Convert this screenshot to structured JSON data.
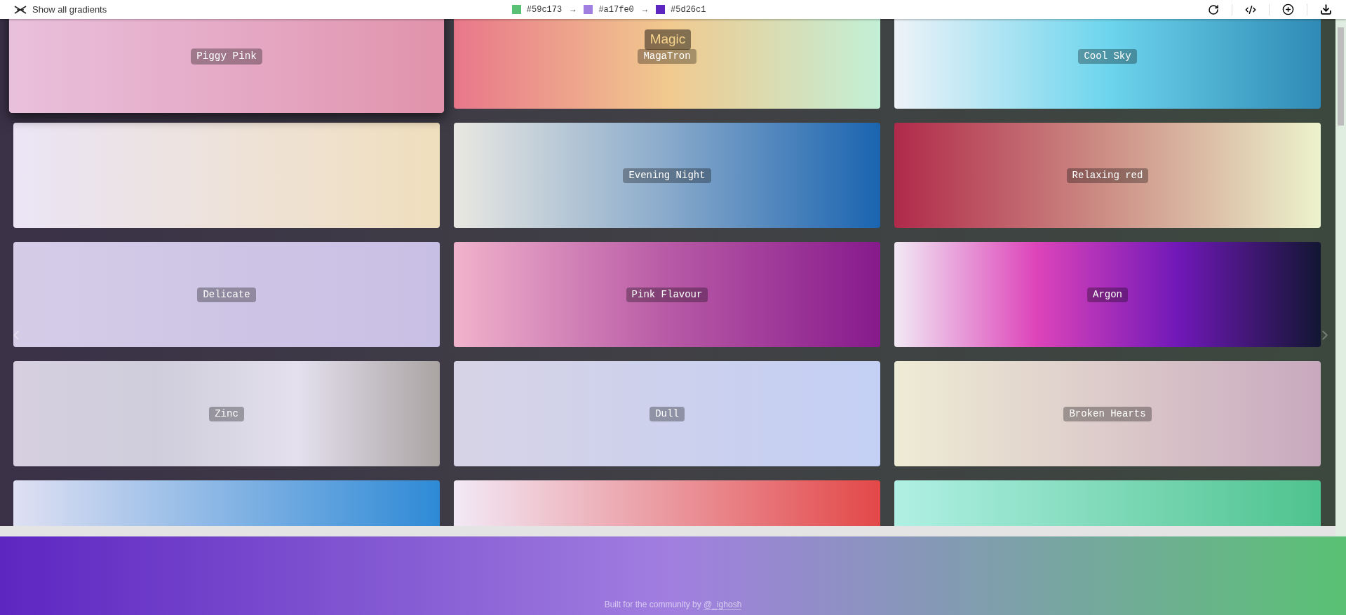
{
  "toolbar": {
    "show_all": "Show all gradients",
    "stops": [
      {
        "hex": "#59c173",
        "color": "#59c173"
      },
      {
        "hex": "#a17fe0",
        "color": "#a17fe0"
      },
      {
        "hex": "#5d26c1",
        "color": "#5d26c1"
      }
    ],
    "arrow": "→"
  },
  "title": "Magic",
  "gradients": [
    {
      "name": "Piggy Pink",
      "highlighted": true
    },
    {
      "name": "MagaTron",
      "highlighted": false
    },
    {
      "name": "Cool Sky",
      "highlighted": false
    },
    {
      "highlighted": false
    },
    {
      "name": "Evening Night",
      "highlighted": false
    },
    {
      "name": "Relaxing red",
      "highlighted": false
    },
    {
      "name": "Delicate",
      "highlighted": false
    },
    {
      "name": "Pink Flavour",
      "highlighted": false
    },
    {
      "name": "Argon",
      "highlighted": false
    },
    {
      "name": "Zinc",
      "highlighted": false
    },
    {
      "name": "Dull",
      "highlighted": false
    },
    {
      "name": "Broken Hearts",
      "highlighted": false
    },
    {
      "highlighted": false
    },
    {
      "highlighted": false
    },
    {
      "highlighted": false
    }
  ],
  "footer": {
    "text": "Built for the community by",
    "link": "@_ighosh"
  }
}
